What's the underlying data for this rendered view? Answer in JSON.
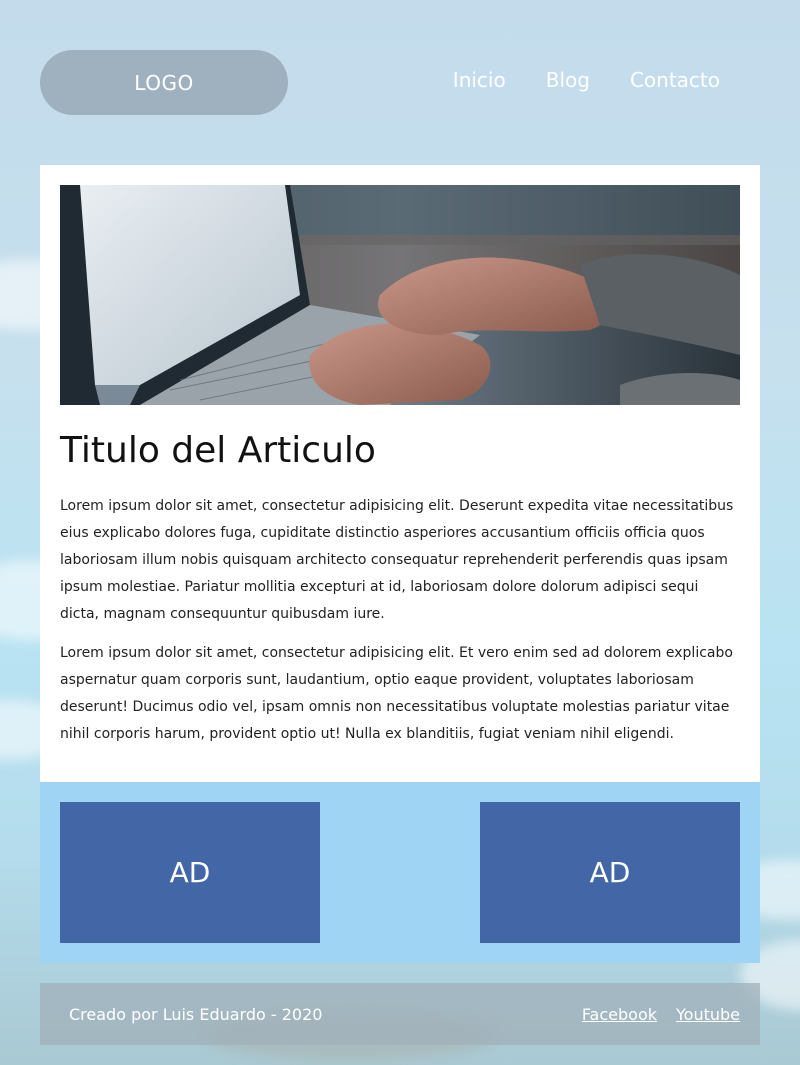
{
  "header": {
    "logo": "LOGO",
    "nav": [
      {
        "label": "Inicio"
      },
      {
        "label": "Blog"
      },
      {
        "label": "Contacto"
      }
    ]
  },
  "article": {
    "image_alt": "laptop-typing-photo",
    "title": "Titulo del Articulo",
    "paragraphs": [
      "Lorem ipsum dolor sit amet, consectetur adipisicing elit. Deserunt expedita vitae necessitatibus eius explicabo dolores fuga, cupiditate distinctio asperiores accusantium officiis officia quos laboriosam illum nobis quisquam architecto consequatur reprehenderit perferendis quas ipsam ipsum molestiae. Pariatur mollitia excepturi at id, laboriosam dolore dolorum adipisci sequi dicta, magnam consequuntur quibusdam iure.",
      "Lorem ipsum dolor sit amet, consectetur adipisicing elit. Et vero enim sed ad dolorem explicabo aspernatur quam corporis sunt, laudantium, optio eaque provident, voluptates laboriosam deserunt! Ducimus odio vel, ipsam omnis non necessitatibus voluptate molestias pariatur vitae nihil corporis harum, provident optio ut! Nulla ex blanditiis, fugiat veniam nihil eligendi."
    ]
  },
  "ads": [
    {
      "label": "AD"
    },
    {
      "label": "AD"
    }
  ],
  "footer": {
    "credit": "Creado por Luis Eduardo - 2020",
    "links": [
      {
        "label": "Facebook"
      },
      {
        "label": "Youtube"
      }
    ]
  },
  "colors": {
    "ad_background": "#4366a6",
    "ads_band": "#a0d4f4",
    "logo_pill": "#9fb1bf"
  }
}
